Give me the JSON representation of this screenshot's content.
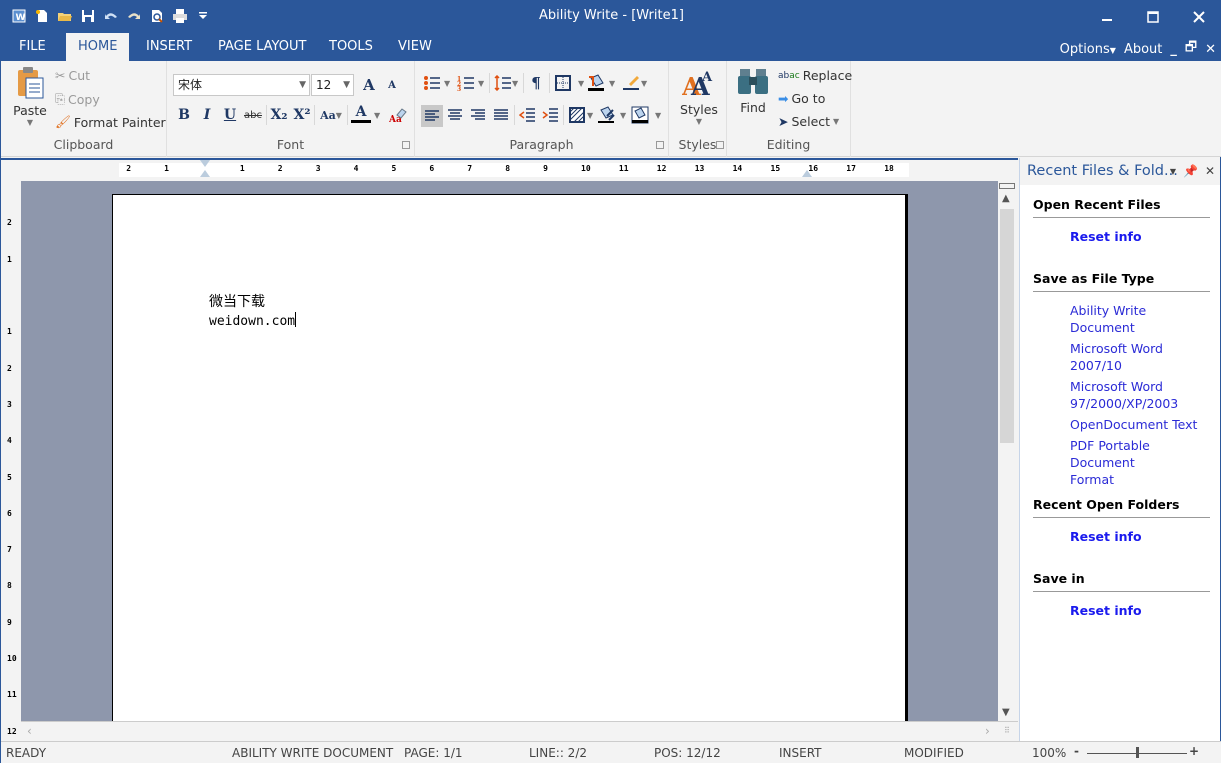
{
  "window": {
    "title": "Ability Write - [Write1]",
    "minimize": "—",
    "maximize": "☐",
    "close": "✕"
  },
  "quick_access": [
    "app-icon",
    "new-icon",
    "open-icon",
    "save-icon",
    "undo-icon",
    "redo-icon",
    "print-preview-icon",
    "print-icon",
    "customize-icon"
  ],
  "tabs": [
    {
      "label": "FILE",
      "active": false
    },
    {
      "label": "HOME",
      "active": true
    },
    {
      "label": "INSERT",
      "active": false
    },
    {
      "label": "PAGE LAYOUT",
      "active": false
    },
    {
      "label": "TOOLS",
      "active": false
    },
    {
      "label": "VIEW",
      "active": false
    }
  ],
  "rightmenu": {
    "options": "Options",
    "about": "About"
  },
  "ribbon": {
    "clipboard": {
      "label": "Clipboard",
      "paste": "Paste",
      "cut": "Cut",
      "copy": "Copy",
      "format_painter": "Format Painter"
    },
    "font": {
      "label": "Font",
      "font_name": "宋体",
      "font_size": "12",
      "bold": "B",
      "italic": "I",
      "underline": "U",
      "strike": "abc",
      "sub": "X₂",
      "sup": "X²",
      "grow": "A",
      "shrink": "A",
      "case": "Aa",
      "color": "A"
    },
    "paragraph": {
      "label": "Paragraph"
    },
    "styles": {
      "label": "Styles",
      "button": "Styles"
    },
    "editing": {
      "label": "Editing",
      "find": "Find",
      "replace": "Replace",
      "goto": "Go to",
      "select": "Select"
    }
  },
  "ruler": {
    "h_ticks": [
      "2",
      "1",
      "1",
      "2",
      "3",
      "4",
      "5",
      "6",
      "7",
      "8",
      "9",
      "10",
      "11",
      "12",
      "13",
      "14",
      "15",
      "16",
      "17",
      "18"
    ],
    "v_ticks": [
      "2",
      "1",
      "1",
      "2",
      "3",
      "4",
      "5",
      "6",
      "7",
      "8",
      "9",
      "10",
      "11",
      "12"
    ]
  },
  "document": {
    "lines": [
      "微当下载",
      "weidown.com"
    ]
  },
  "pane": {
    "title": "Recent Files & Fold...",
    "sections": [
      {
        "title": "Open Recent Files",
        "links": [
          "Reset info"
        ]
      },
      {
        "title": "Save as File Type",
        "links": [
          "Ability Write Document",
          "Microsoft Word 2007/10",
          "Microsoft Word 97/2000/XP/2003",
          "OpenDocument Text",
          "PDF Portable Document Format"
        ]
      },
      {
        "title": "Recent Open Folders",
        "links": [
          "Reset info"
        ]
      },
      {
        "title": "Save in",
        "links": [
          "Reset info"
        ]
      }
    ]
  },
  "status": {
    "ready": "READY",
    "doctype": "ABILITY WRITE DOCUMENT",
    "page": "PAGE: 1/1",
    "line": "LINE:: 2/2",
    "pos": "POS: 12/12",
    "mode": "INSERT",
    "modified": "MODIFIED",
    "zoom": "100%",
    "zoom_level_percent": 100
  },
  "colors": {
    "brand": "#2b579a",
    "link": "#2b2bd6",
    "doc_bg": "#8e97ac"
  }
}
